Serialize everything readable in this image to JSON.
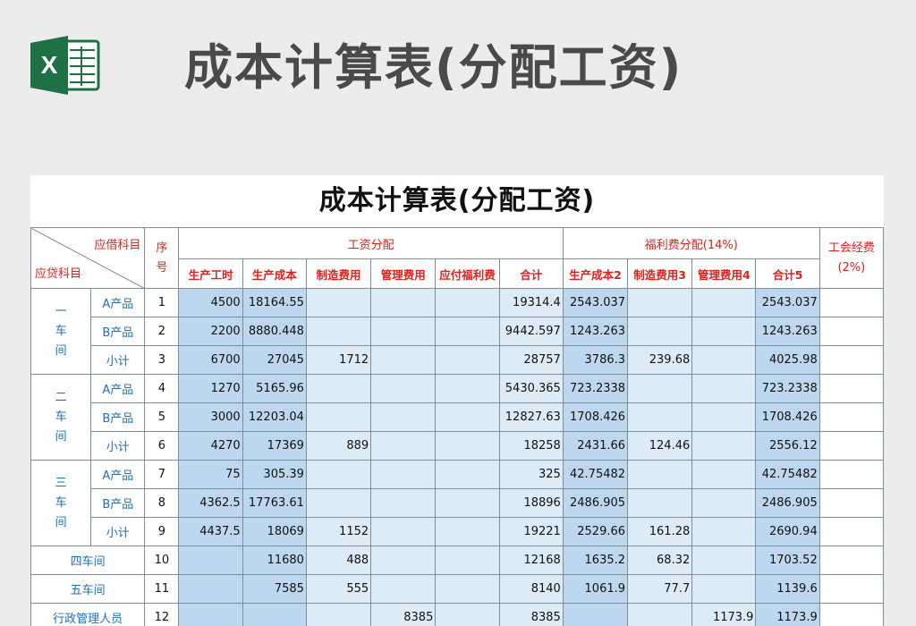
{
  "heading": "成本计算表(分配工资)",
  "sheet_title": "成本计算表(分配工资)",
  "logo_letter": "X",
  "header": {
    "debit_label": "应借科目",
    "credit_label": "应贷科目",
    "seq_chars": [
      "序",
      "号"
    ],
    "wage_group": "工资分配",
    "welfare_group": "福利费分配(14%)",
    "union_line1": "工会经费",
    "union_line2": "(2%)",
    "wage_cols": [
      "生产工时",
      "生产成本",
      "制造费用",
      "管理费用",
      "应付福利费",
      "合计"
    ],
    "welfare_cols": [
      "生产成本2",
      "制造费用3",
      "管理费用4",
      "合计5"
    ]
  },
  "workshops": [
    {
      "name_chars": [
        "一",
        "车",
        "间"
      ],
      "rows": [
        {
          "item": "A产品",
          "seq": "1",
          "hours": "4500",
          "prod": "18164.55",
          "mfg": "",
          "mgmt": "",
          "welfare": "",
          "total": "19314.4",
          "w_prod": "2543.037",
          "w_mfg": "",
          "w_mgmt": "",
          "w_total": "2543.037",
          "union": ""
        },
        {
          "item": "B产品",
          "seq": "2",
          "hours": "2200",
          "prod": "8880.448",
          "mfg": "",
          "mgmt": "",
          "welfare": "",
          "total": "9442.597",
          "w_prod": "1243.263",
          "w_mfg": "",
          "w_mgmt": "",
          "w_total": "1243.263",
          "union": ""
        },
        {
          "item": "小计",
          "seq": "3",
          "hours": "6700",
          "prod": "27045",
          "mfg": "1712",
          "mgmt": "",
          "welfare": "",
          "total": "28757",
          "w_prod": "3786.3",
          "w_mfg": "239.68",
          "w_mgmt": "",
          "w_total": "4025.98",
          "union": ""
        }
      ]
    },
    {
      "name_chars": [
        "二",
        "车",
        "间"
      ],
      "rows": [
        {
          "item": "A产品",
          "seq": "4",
          "hours": "1270",
          "prod": "5165.96",
          "mfg": "",
          "mgmt": "",
          "welfare": "",
          "total": "5430.365",
          "w_prod": "723.2338",
          "w_mfg": "",
          "w_mgmt": "",
          "w_total": "723.2338",
          "union": ""
        },
        {
          "item": "B产品",
          "seq": "5",
          "hours": "3000",
          "prod": "12203.04",
          "mfg": "",
          "mgmt": "",
          "welfare": "",
          "total": "12827.63",
          "w_prod": "1708.426",
          "w_mfg": "",
          "w_mgmt": "",
          "w_total": "1708.426",
          "union": ""
        },
        {
          "item": "小计",
          "seq": "6",
          "hours": "4270",
          "prod": "17369",
          "mfg": "889",
          "mgmt": "",
          "welfare": "",
          "total": "18258",
          "w_prod": "2431.66",
          "w_mfg": "124.46",
          "w_mgmt": "",
          "w_total": "2556.12",
          "union": ""
        }
      ]
    },
    {
      "name_chars": [
        "三",
        "车",
        "间"
      ],
      "rows": [
        {
          "item": "A产品",
          "seq": "7",
          "hours": "75",
          "prod": "305.39",
          "mfg": "",
          "mgmt": "",
          "welfare": "",
          "total": "325",
          "w_prod": "42.75482",
          "w_mfg": "",
          "w_mgmt": "",
          "w_total": "42.75482",
          "union": ""
        },
        {
          "item": "B产品",
          "seq": "8",
          "hours": "4362.5",
          "prod": "17763.61",
          "mfg": "",
          "mgmt": "",
          "welfare": "",
          "total": "18896",
          "w_prod": "2486.905",
          "w_mfg": "",
          "w_mgmt": "",
          "w_total": "2486.905",
          "union": ""
        },
        {
          "item": "小计",
          "seq": "9",
          "hours": "4437.5",
          "prod": "18069",
          "mfg": "1152",
          "mgmt": "",
          "welfare": "",
          "total": "19221",
          "w_prod": "2529.66",
          "w_mfg": "161.28",
          "w_mgmt": "",
          "w_total": "2690.94",
          "union": ""
        }
      ]
    }
  ],
  "other_rows": [
    {
      "name": "四车间",
      "seq": "10",
      "hours": "",
      "prod": "11680",
      "mfg": "488",
      "mgmt": "",
      "welfare": "",
      "total": "12168",
      "w_prod": "1635.2",
      "w_mfg": "68.32",
      "w_mgmt": "",
      "w_total": "1703.52",
      "union": ""
    },
    {
      "name": "五车间",
      "seq": "11",
      "hours": "",
      "prod": "7585",
      "mfg": "555",
      "mgmt": "",
      "welfare": "",
      "total": "8140",
      "w_prod": "1061.9",
      "w_mfg": "77.7",
      "w_mgmt": "",
      "w_total": "1139.6",
      "union": ""
    },
    {
      "name": "行政管理人员",
      "seq": "12",
      "hours": "",
      "prod": "",
      "mfg": "",
      "mgmt": "8385",
      "welfare": "",
      "total": "8385",
      "w_prod": "",
      "w_mfg": "",
      "w_mgmt": "1173.9",
      "w_total": "1173.9",
      "union": ""
    }
  ],
  "colors": {
    "header_red": "#e0201b",
    "label_blue": "#1f6fb6",
    "cell_shade_dark": "#bdd7ee",
    "cell_shade_light": "#ddebf7",
    "excel_green": "#1e7145"
  }
}
